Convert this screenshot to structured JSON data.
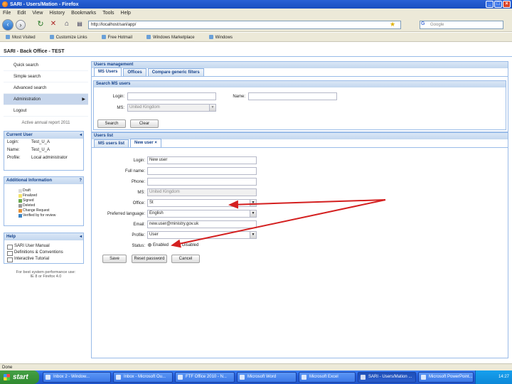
{
  "window": {
    "title": "SARI - Users/Mation - Firefox"
  },
  "menu": [
    "File",
    "Edit",
    "View",
    "History",
    "Bookmarks",
    "Tools",
    "Help"
  ],
  "nav": {
    "url": "http://localhost/sari/app/",
    "search_placeholder": "Google"
  },
  "bookmarks": [
    "Most Visited",
    "Customize Links",
    "Free Hotmail",
    "Windows Marketplace",
    "Windows"
  ],
  "app": {
    "header": "SARI - Back Office - TEST"
  },
  "sidebar": {
    "items": [
      "Quick search",
      "Simple search",
      "Advanced search",
      "Administration",
      "Logout"
    ],
    "note": "Active annual report 2011",
    "current_user": {
      "title": "Current User",
      "rows": [
        {
          "k": "Login:",
          "v": "Test_U_A"
        },
        {
          "k": "Name:",
          "v": "Test_U_A"
        },
        {
          "k": "Profile:",
          "v": "Local administrator"
        }
      ]
    },
    "additional": {
      "title": "Additional Information",
      "legend": [
        {
          "label": "Draft",
          "color": "#d9d9d9"
        },
        {
          "label": "Finalized",
          "color": "#f4e36b"
        },
        {
          "label": "Signed",
          "color": "#6aa84f"
        },
        {
          "label": "Deleted",
          "color": "#999999"
        },
        {
          "label": "Change Request",
          "color": "#e69138"
        },
        {
          "label": "Verified by for review",
          "color": "#3d85c6"
        }
      ]
    },
    "help": {
      "title": "Help",
      "items": [
        "SARI User Manual",
        "Definitions & Conventions",
        "Interactive Tutorial"
      ]
    },
    "footer": [
      "For best system performance use:",
      "IE 8 or Firefox 4.0"
    ]
  },
  "users_mgmt": {
    "title": "Users management",
    "tabs": [
      "MS Users",
      "Offices",
      "Compare generic filters"
    ],
    "search": {
      "title": "Search MS users",
      "login_label": "Login:",
      "name_label": "Name:",
      "ms_label": "MS:",
      "ms_value": "United Kingdom",
      "search_btn": "Search",
      "clear_btn": "Clear"
    },
    "list": {
      "title": "Users list",
      "tabs": [
        "MS users list",
        "New user"
      ],
      "fields": [
        {
          "label": "Login:",
          "value": "New user",
          "type": "text"
        },
        {
          "label": "Full name:",
          "value": "",
          "type": "text"
        },
        {
          "label": "Phone:",
          "value": "",
          "type": "text"
        },
        {
          "label": "MS:",
          "value": "United Kingdom",
          "type": "text"
        },
        {
          "label": "Office:",
          "value": "St",
          "type": "select"
        },
        {
          "label": "Preferred language:",
          "value": "English",
          "type": "select"
        },
        {
          "label": "Email:",
          "value": "new.user@ministry.gov.uk",
          "type": "text"
        },
        {
          "label": "Profile:",
          "value": "User",
          "type": "select"
        }
      ],
      "status_label": "Status:",
      "status_options": [
        "Enabled",
        "Disabled"
      ],
      "buttons": [
        "Save",
        "Reset password",
        "Cancel"
      ]
    }
  },
  "statusbar": {
    "text": "Done"
  },
  "taskbar": {
    "start": "start",
    "tasks": [
      "Inbox 2 - Window...",
      "Inbox - Microsoft Ou...",
      "FTF Office 2010 - N...",
      "Microsoft Word",
      "Microsoft Excel",
      "SARI - Users/Mation ...",
      "Microsoft PowerPoint..."
    ],
    "clock": "14:27"
  },
  "colors": {
    "accent": "#15428b",
    "panel_border": "#99bbe8",
    "arrow": "#d42020"
  }
}
